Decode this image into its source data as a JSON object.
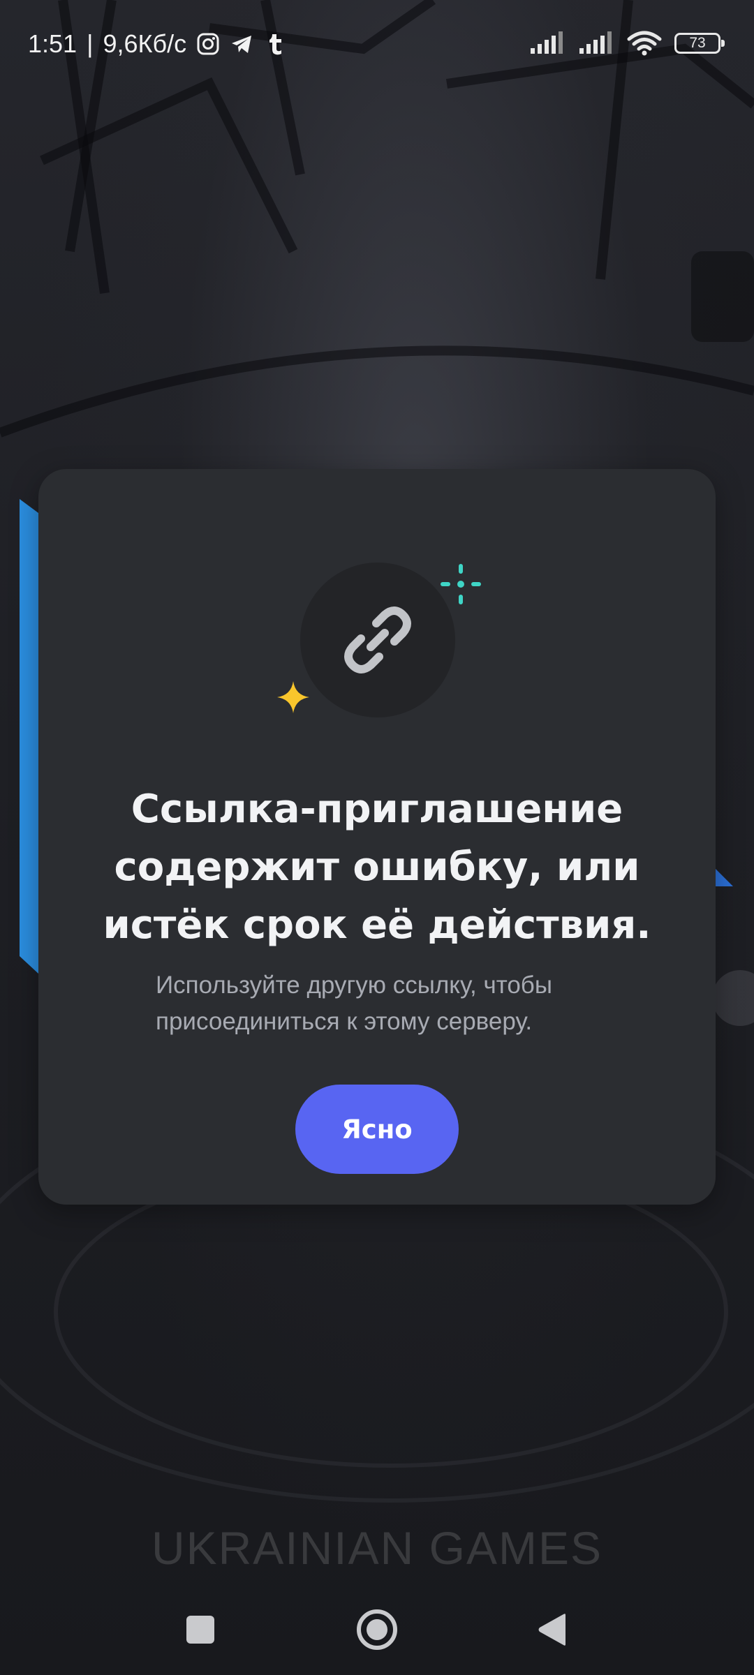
{
  "status_bar": {
    "time": "1:51",
    "separator": "|",
    "network_speed": "9,6Кб/с",
    "notification_icons": [
      "instagram-icon",
      "telegram-icon",
      "tumblr-icon"
    ],
    "battery_level": "73"
  },
  "modal": {
    "title": "Ссылка-приглашение содержит ошибку, или истёк срок её действия.",
    "subtitle": "Используйте другую ссылку, чтобы присоединиться к этому серверу.",
    "button_label": "Ясно",
    "icon": "link-icon"
  },
  "background": {
    "watermark": "UKRAINIAN GAMES"
  },
  "colors": {
    "accent": "#5865f2",
    "modal_background": "#2b2d31",
    "sparkle_teal": "#3fd5c6",
    "sparkle_yellow": "#f9c62c"
  }
}
